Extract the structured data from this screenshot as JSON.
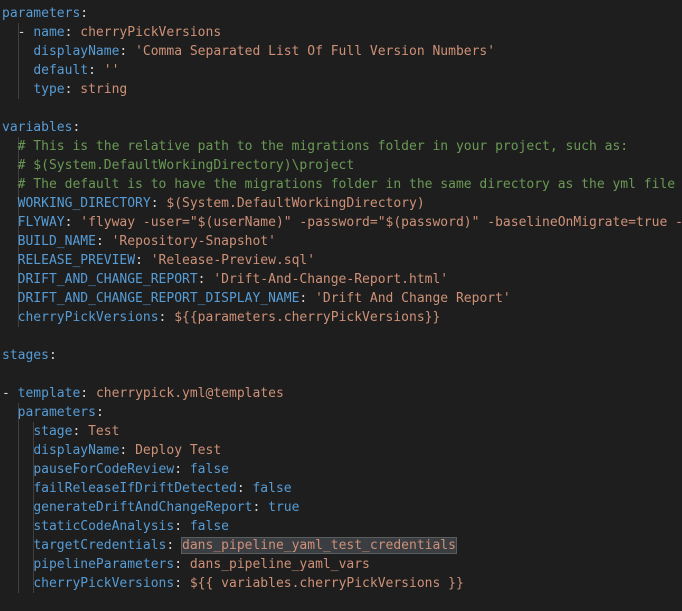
{
  "colors": {
    "background": "#1e1e1e",
    "key": "#569cd6",
    "string": "#ce9178",
    "comment": "#6a9955",
    "punctuation": "#d4d4d4"
  },
  "lines": [
    [
      {
        "k": "key",
        "t": "parameters"
      },
      {
        "k": "pun",
        "t": ":"
      }
    ],
    [
      {
        "k": "pun",
        "t": "  - "
      },
      {
        "k": "key",
        "t": "name"
      },
      {
        "k": "pun",
        "t": ": "
      },
      {
        "k": "str",
        "t": "cherryPickVersions"
      }
    ],
    [
      {
        "k": "pun",
        "t": "    "
      },
      {
        "k": "key",
        "t": "displayName"
      },
      {
        "k": "pun",
        "t": ": "
      },
      {
        "k": "str",
        "t": "'Comma Separated List Of Full Version Numbers'"
      }
    ],
    [
      {
        "k": "pun",
        "t": "    "
      },
      {
        "k": "key",
        "t": "default"
      },
      {
        "k": "pun",
        "t": ": "
      },
      {
        "k": "str",
        "t": "''"
      }
    ],
    [
      {
        "k": "pun",
        "t": "    "
      },
      {
        "k": "key",
        "t": "type"
      },
      {
        "k": "pun",
        "t": ": "
      },
      {
        "k": "str",
        "t": "string"
      }
    ],
    [],
    [
      {
        "k": "key",
        "t": "variables"
      },
      {
        "k": "pun",
        "t": ":"
      }
    ],
    [
      {
        "k": "pun",
        "t": "  "
      },
      {
        "k": "cmt",
        "t": "# This is the relative path to the migrations folder in your project, such as:"
      }
    ],
    [
      {
        "k": "pun",
        "t": "  "
      },
      {
        "k": "cmt",
        "t": "# $(System.DefaultWorkingDirectory)\\project"
      }
    ],
    [
      {
        "k": "pun",
        "t": "  "
      },
      {
        "k": "cmt",
        "t": "# The default is to have the migrations folder in the same directory as the yml file"
      }
    ],
    [
      {
        "k": "pun",
        "t": "  "
      },
      {
        "k": "key",
        "t": "WORKING_DIRECTORY"
      },
      {
        "k": "pun",
        "t": ": "
      },
      {
        "k": "str",
        "t": "$(System.DefaultWorkingDirectory)"
      }
    ],
    [
      {
        "k": "pun",
        "t": "  "
      },
      {
        "k": "key",
        "t": "FLYWAY"
      },
      {
        "k": "pun",
        "t": ": "
      },
      {
        "k": "str",
        "t": "'flyway -user=\"$(userName)\" -password=\"$(password)\" -baselineOnMigrate=true -"
      }
    ],
    [
      {
        "k": "pun",
        "t": "  "
      },
      {
        "k": "key",
        "t": "BUILD_NAME"
      },
      {
        "k": "pun",
        "t": ": "
      },
      {
        "k": "str",
        "t": "'Repository-Snapshot'"
      }
    ],
    [
      {
        "k": "pun",
        "t": "  "
      },
      {
        "k": "key",
        "t": "RELEASE_PREVIEW"
      },
      {
        "k": "pun",
        "t": ": "
      },
      {
        "k": "str",
        "t": "'Release-Preview.sql'"
      }
    ],
    [
      {
        "k": "pun",
        "t": "  "
      },
      {
        "k": "key",
        "t": "DRIFT_AND_CHANGE_REPORT"
      },
      {
        "k": "pun",
        "t": ": "
      },
      {
        "k": "str",
        "t": "'Drift-And-Change-Report.html'"
      }
    ],
    [
      {
        "k": "pun",
        "t": "  "
      },
      {
        "k": "key",
        "t": "DRIFT_AND_CHANGE_REPORT_DISPLAY_NAME"
      },
      {
        "k": "pun",
        "t": ": "
      },
      {
        "k": "str",
        "t": "'Drift And Change Report'"
      }
    ],
    [
      {
        "k": "pun",
        "t": "  "
      },
      {
        "k": "key",
        "t": "cherryPickVersions"
      },
      {
        "k": "pun",
        "t": ": "
      },
      {
        "k": "str",
        "t": "${{parameters.cherryPickVersions}}"
      }
    ],
    [],
    [
      {
        "k": "key",
        "t": "stages"
      },
      {
        "k": "pun",
        "t": ":"
      }
    ],
    [],
    [
      {
        "k": "pun",
        "t": "- "
      },
      {
        "k": "key",
        "t": "template"
      },
      {
        "k": "pun",
        "t": ": "
      },
      {
        "k": "str",
        "t": "cherrypick.yml@templates"
      }
    ],
    [
      {
        "k": "pun",
        "t": "  "
      },
      {
        "k": "key",
        "t": "parameters"
      },
      {
        "k": "pun",
        "t": ":"
      }
    ],
    [
      {
        "k": "pun",
        "t": "    "
      },
      {
        "k": "key",
        "t": "stage"
      },
      {
        "k": "pun",
        "t": ": "
      },
      {
        "k": "str",
        "t": "Test"
      }
    ],
    [
      {
        "k": "pun",
        "t": "    "
      },
      {
        "k": "key",
        "t": "displayName"
      },
      {
        "k": "pun",
        "t": ": "
      },
      {
        "k": "str",
        "t": "Deploy Test"
      }
    ],
    [
      {
        "k": "pun",
        "t": "    "
      },
      {
        "k": "key",
        "t": "pauseForCodeReview"
      },
      {
        "k": "pun",
        "t": ": "
      },
      {
        "k": "key",
        "t": "false"
      }
    ],
    [
      {
        "k": "pun",
        "t": "    "
      },
      {
        "k": "key",
        "t": "failReleaseIfDriftDetected"
      },
      {
        "k": "pun",
        "t": ": "
      },
      {
        "k": "key",
        "t": "false"
      }
    ],
    [
      {
        "k": "pun",
        "t": "    "
      },
      {
        "k": "key",
        "t": "generateDriftAndChangeReport"
      },
      {
        "k": "pun",
        "t": ": "
      },
      {
        "k": "key",
        "t": "true"
      }
    ],
    [
      {
        "k": "pun",
        "t": "    "
      },
      {
        "k": "key",
        "t": "staticCodeAnalysis"
      },
      {
        "k": "pun",
        "t": ": "
      },
      {
        "k": "key",
        "t": "false"
      }
    ],
    [
      {
        "k": "pun",
        "t": "    "
      },
      {
        "k": "key",
        "t": "targetCredentials"
      },
      {
        "k": "pun",
        "t": ": "
      },
      {
        "k": "str",
        "t": "dans_pipeline_yaml_test_credentials",
        "hl": true
      }
    ],
    [
      {
        "k": "pun",
        "t": "    "
      },
      {
        "k": "key",
        "t": "pipelineParameters"
      },
      {
        "k": "pun",
        "t": ": "
      },
      {
        "k": "str",
        "t": "dans_pipeline_yaml_vars"
      }
    ],
    [
      {
        "k": "pun",
        "t": "    "
      },
      {
        "k": "key",
        "t": "cherryPickVersions"
      },
      {
        "k": "pun",
        "t": ": "
      },
      {
        "k": "str",
        "t": "${{ variables.cherryPickVersions }}"
      }
    ]
  ]
}
